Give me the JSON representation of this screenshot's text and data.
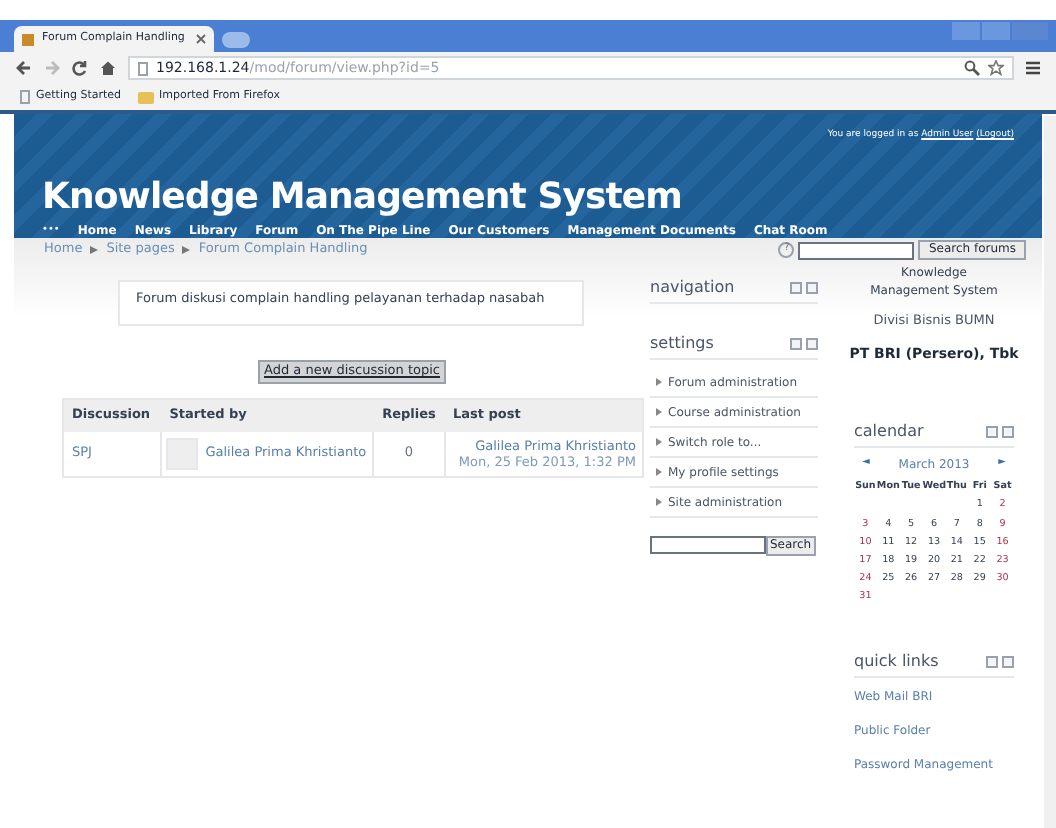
{
  "browser": {
    "tab_title": "Forum Complain Handling",
    "url_host": "192.168.1.24",
    "url_path": "/mod/forum/view.php?id=5",
    "bookmarks": [
      "Getting Started",
      "Imported From Firefox"
    ]
  },
  "header": {
    "login_prefix": "You are logged in as",
    "user": "Admin User",
    "logout": "(Logout)",
    "site_title": "Knowledge Management System",
    "menu_marker": "•••",
    "menu": [
      "Home",
      "News",
      "Library",
      "Forum",
      "On The Pipe Line",
      "Our Customers",
      "Management Documents",
      "Chat Room"
    ]
  },
  "breadcrumb": [
    "Home",
    "Site pages",
    "Forum Complain Handling"
  ],
  "search_forums": {
    "help": "?",
    "button": "Search forums"
  },
  "intro": "Forum diskusi complain handling pelayanan terhadap nasabah",
  "add_button": "Add a new discussion topic",
  "table": {
    "columns": [
      "Discussion",
      "Started by",
      "Replies",
      "Last post"
    ],
    "rows": [
      {
        "discussion": "SPJ",
        "started_by": "Galilea Prima Khristianto",
        "replies": "0",
        "last_post_by": "Galilea Prima Khristianto",
        "last_post_date": "Mon, 25 Feb 2013, 1:32 PM"
      }
    ]
  },
  "navigation": {
    "title": "navigation"
  },
  "settings": {
    "title": "settings",
    "items": [
      "Forum administration",
      "Course administration",
      "Switch role to...",
      "My profile settings",
      "Site administration"
    ],
    "search_button": "Search"
  },
  "org": {
    "line1": "Knowledge Management System",
    "line2": "Divisi Bisnis BUMN",
    "line3": "PT BRI (Persero), Tbk"
  },
  "calendar": {
    "title": "calendar",
    "prev": "◄",
    "month": "March 2013",
    "next": "►",
    "weekdays": [
      "Sun",
      "Mon",
      "Tue",
      "Wed",
      "Thu",
      "Fri",
      "Sat"
    ],
    "weeks": [
      {
        "kind": "first",
        "days": [
          "1",
          "2"
        ]
      },
      {
        "kind": "full",
        "days": [
          "3",
          "4",
          "5",
          "6",
          "7",
          "8",
          "9"
        ]
      },
      {
        "kind": "full",
        "days": [
          "10",
          "11",
          "12",
          "13",
          "14",
          "15",
          "16"
        ]
      },
      {
        "kind": "full",
        "days": [
          "17",
          "18",
          "19",
          "20",
          "21",
          "22",
          "23"
        ]
      },
      {
        "kind": "full",
        "days": [
          "24",
          "25",
          "26",
          "27",
          "28",
          "29",
          "30"
        ]
      },
      {
        "kind": "last",
        "days": [
          "31"
        ]
      }
    ]
  },
  "quick_links": {
    "title": "quick links",
    "links": [
      "Web Mail BRI",
      "Public Folder",
      "Password Management"
    ]
  }
}
